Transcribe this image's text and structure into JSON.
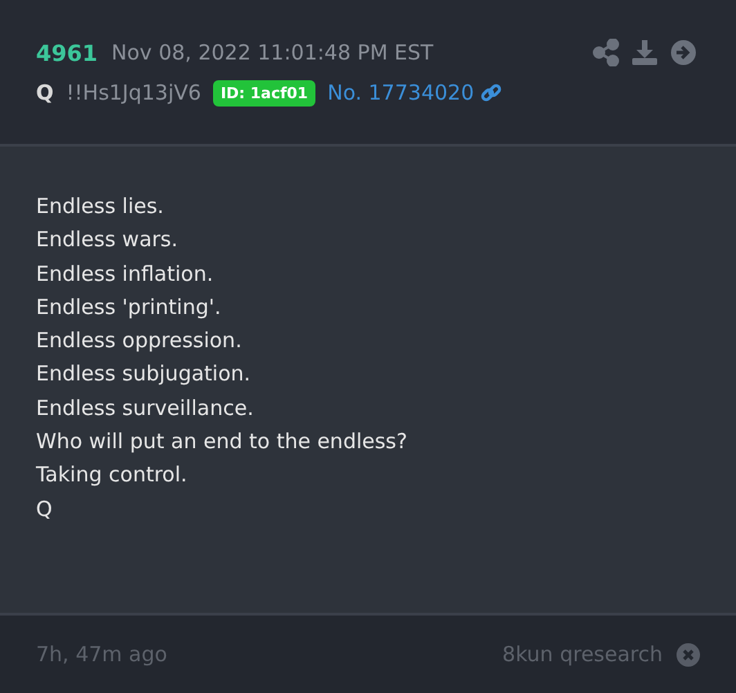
{
  "post": {
    "number": "4961",
    "timestamp": "Nov 08, 2022 11:01:48 PM EST",
    "author": "Q",
    "tripcode": "!!Hs1Jq13jV6",
    "id_badge": "ID: 1acf01",
    "post_link": "No. 17734020"
  },
  "lines": [
    "Endless lies.",
    "Endless wars.",
    "Endless inflation.",
    "Endless 'printing'.",
    "Endless oppression.",
    "Endless subjugation.",
    "Endless surveillance.",
    "Who will put an end to the endless?",
    "Taking control.",
    "Q"
  ],
  "footer": {
    "age": "7h, 47m ago",
    "source": "8kun qresearch"
  }
}
